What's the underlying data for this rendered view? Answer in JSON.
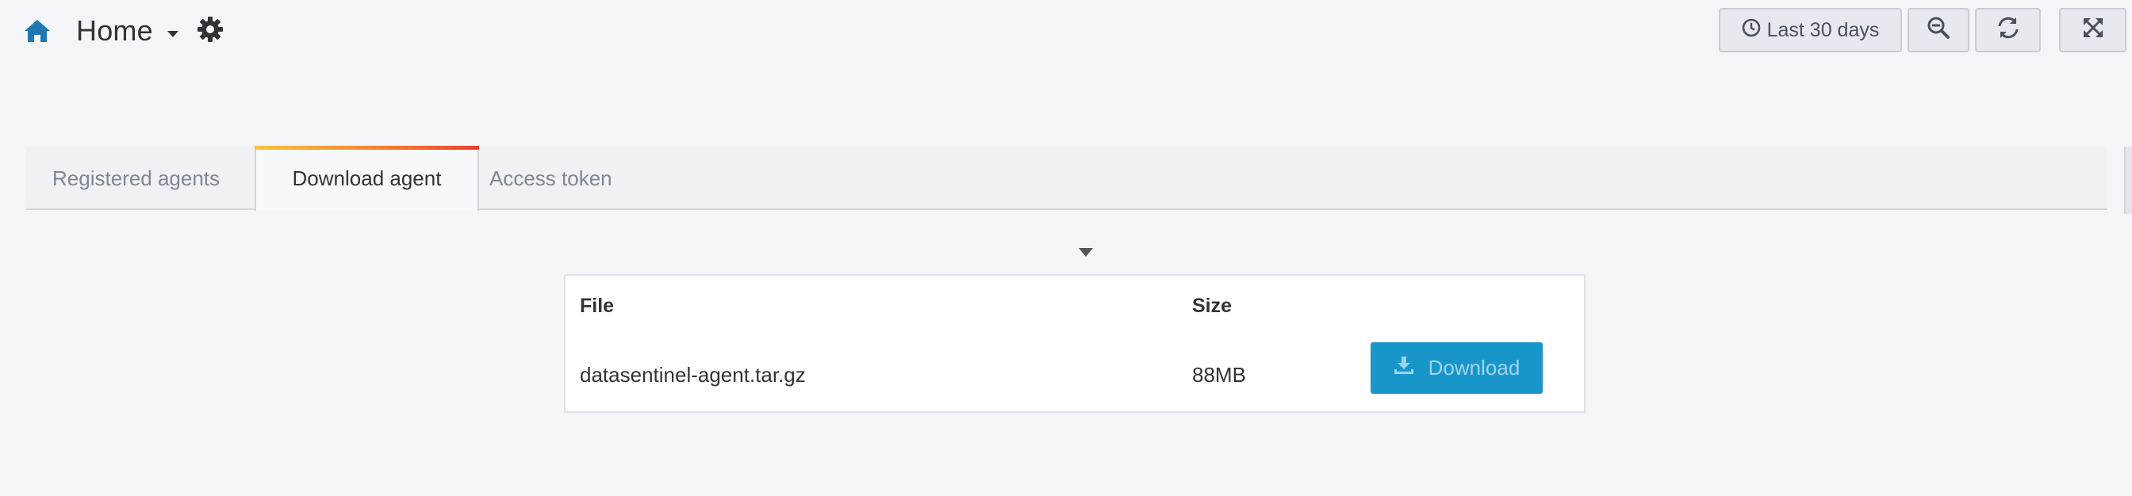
{
  "header": {
    "title": "Home",
    "home_icon": "home-icon",
    "dropdown_icon": "caret-down-icon",
    "settings_icon": "gear-icon"
  },
  "toolbar": {
    "time_range_label": "Last 30 days",
    "time_icon": "clock-icon",
    "zoom_icon": "zoom-out-icon",
    "refresh_icon": "refresh-icon",
    "kiosk_icon": "expand-icon"
  },
  "tabs": [
    {
      "label": "Registered agents",
      "active": false
    },
    {
      "label": "Download agent",
      "active": true
    },
    {
      "label": "Access token",
      "active": false
    }
  ],
  "table": {
    "headers": {
      "file": "File",
      "size": "Size"
    },
    "rows": [
      {
        "file": "datasentinel-agent.tar.gz",
        "size": "88MB",
        "action_label": "Download"
      }
    ]
  },
  "colors": {
    "accent": "#1996c9",
    "home_icon": "#1f78b4",
    "tab_highlight_start": "#f7c33c",
    "tab_highlight_end": "#e8412a"
  }
}
